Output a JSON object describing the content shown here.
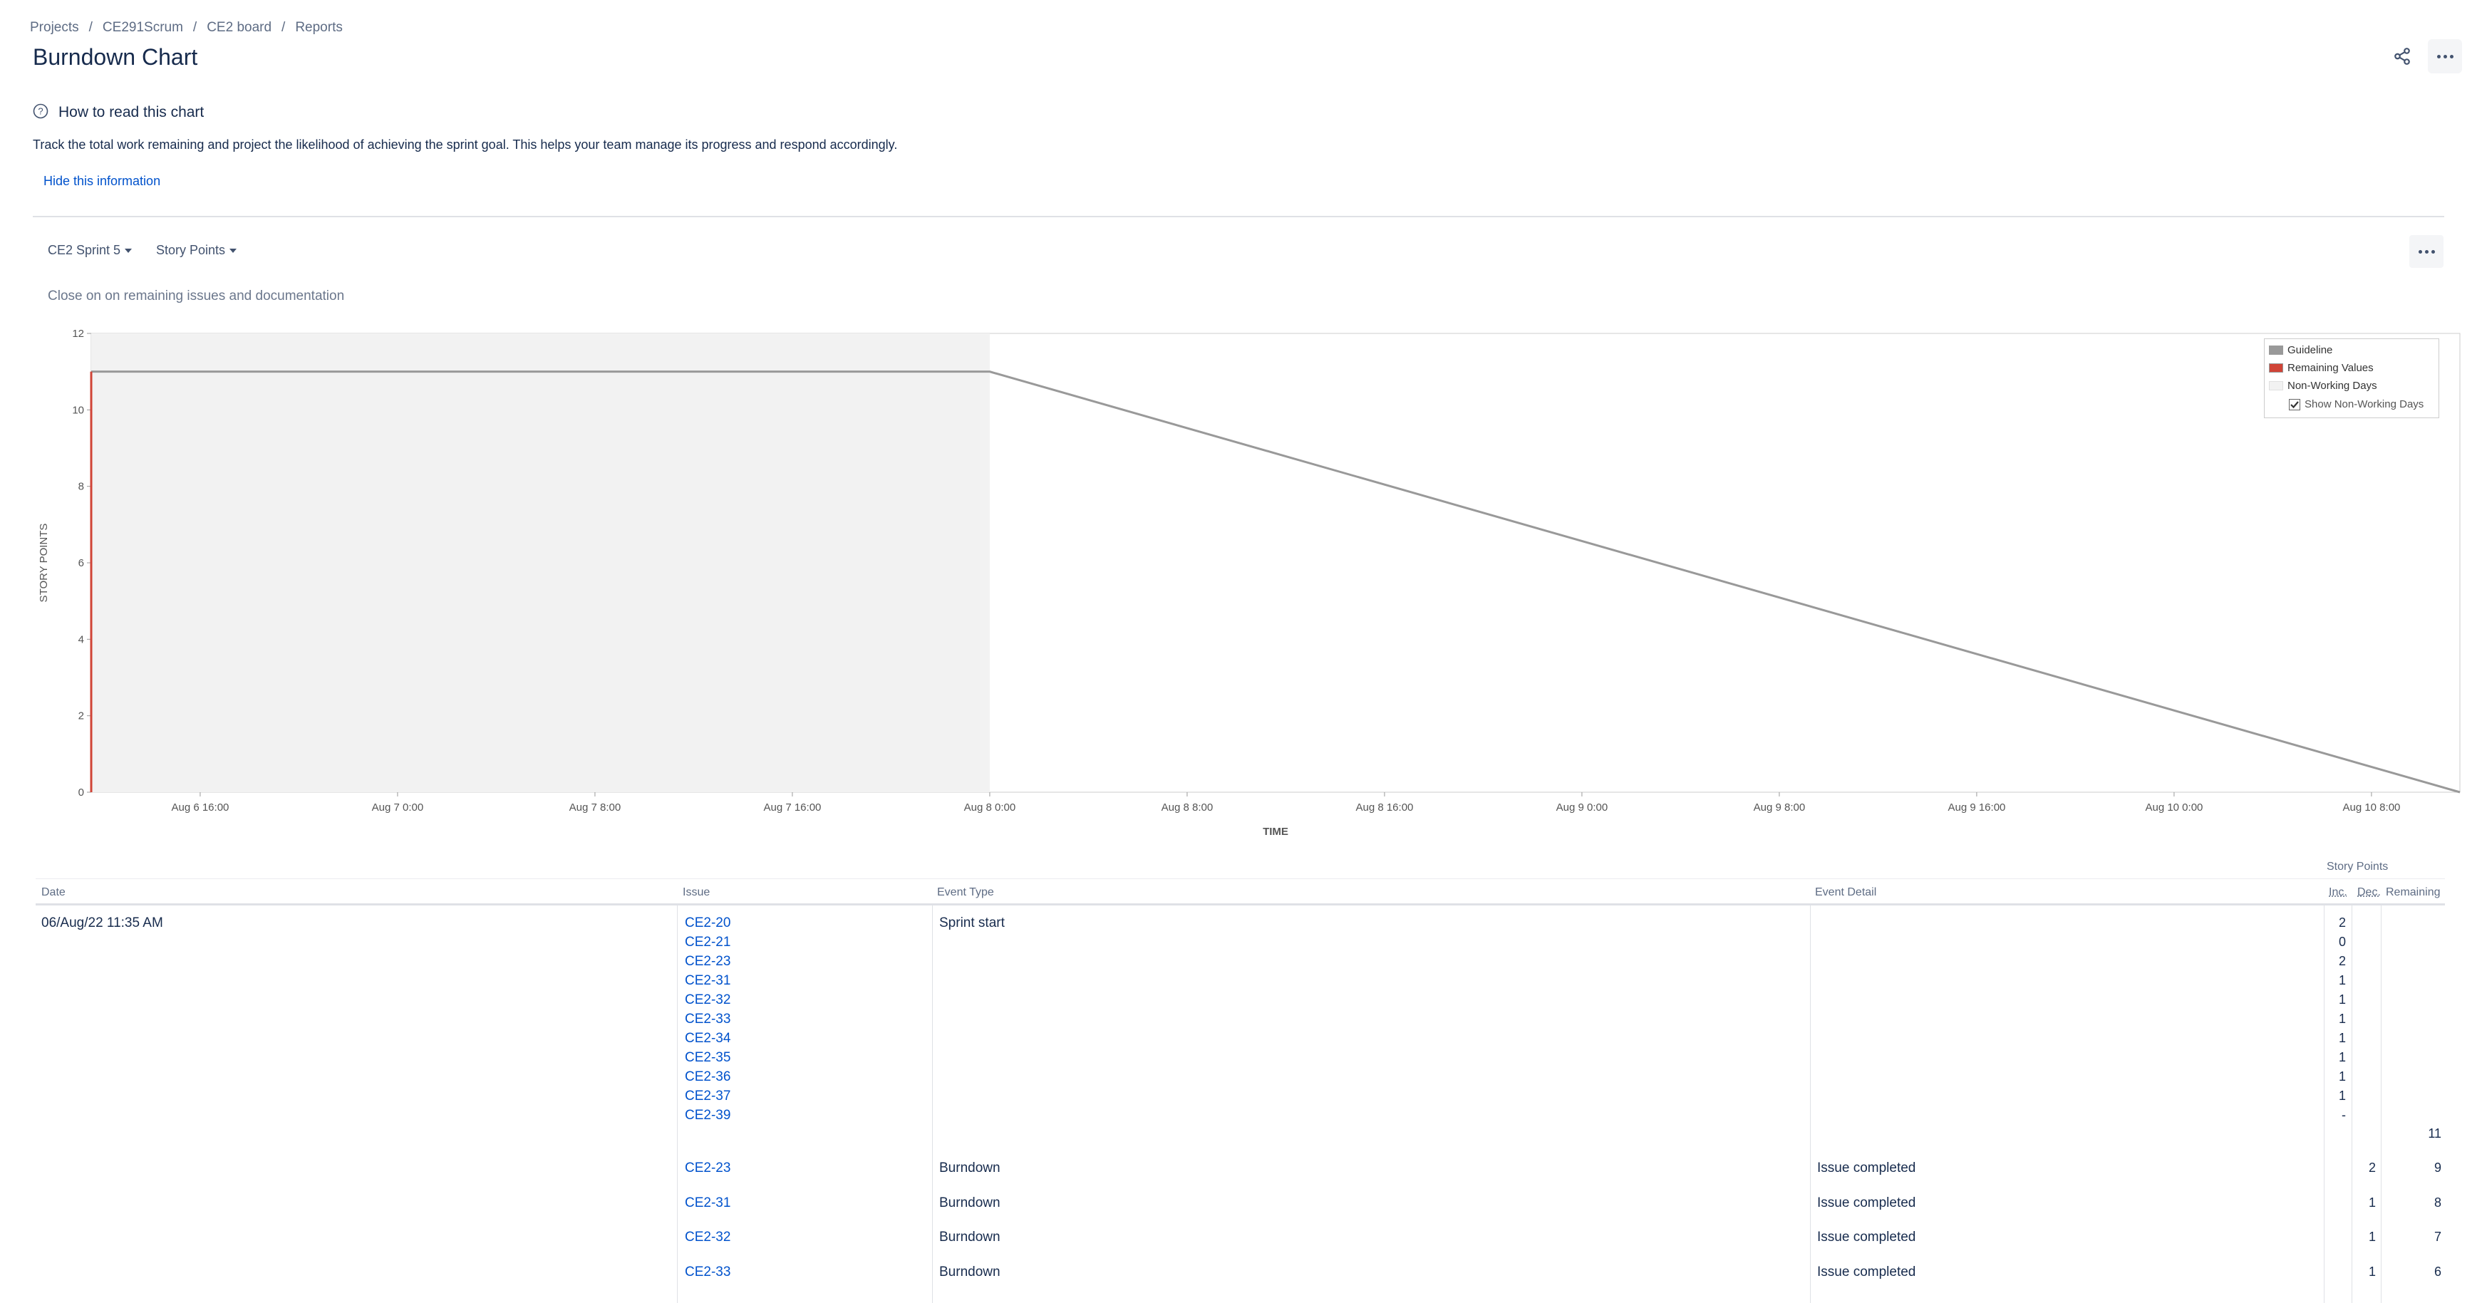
{
  "breadcrumb": [
    "Projects",
    "CE291Scrum",
    "CE2 board",
    "Reports"
  ],
  "page_title": "Burndown Chart",
  "info": {
    "title": "How to read this chart",
    "text": "Track the total work remaining and project the likelihood of achieving the sprint goal. This helps your team manage its progress and respond accordingly.",
    "hide_link": "Hide this information"
  },
  "controls": {
    "sprint": "CE2 Sprint 5",
    "statistic": "Story Points",
    "sprint_goal": "Close on on remaining issues and documentation"
  },
  "legend": {
    "guideline": "Guideline",
    "remaining": "Remaining Values",
    "non_working": "Non-Working Days",
    "show_non_working": "Show Non-Working Days"
  },
  "colors": {
    "guideline": "#999999",
    "remaining": "#d04437",
    "non_working": "#f2f2f2",
    "link": "#0052cc"
  },
  "chart_data": {
    "type": "line",
    "ylabel": "STORY POINTS",
    "xlabel": "TIME",
    "ylim": [
      0,
      12
    ],
    "yticks": [
      0,
      2,
      4,
      6,
      8,
      10,
      12
    ],
    "xlim": [
      "2022-08-06 11:35",
      "2022-08-10 11:35"
    ],
    "xticks": [
      "Aug 6 16:00",
      "Aug 7 0:00",
      "Aug 7 8:00",
      "Aug 7 16:00",
      "Aug 8 0:00",
      "Aug 8 8:00",
      "Aug 8 16:00",
      "Aug 9 0:00",
      "Aug 9 8:00",
      "Aug 9 16:00",
      "Aug 10 0:00",
      "Aug 10 8:00"
    ],
    "non_working_days": [
      [
        "2022-08-06 11:35",
        "2022-08-08 00:00"
      ]
    ],
    "legend_position": "top-right",
    "series": [
      {
        "name": "Guideline",
        "points": [
          [
            "2022-08-06 11:35",
            11
          ],
          [
            "2022-08-08 00:00",
            11
          ],
          [
            "2022-08-10 11:35",
            0
          ]
        ]
      },
      {
        "name": "Remaining Values",
        "points": [
          [
            "2022-08-06 11:35",
            0
          ],
          [
            "2022-08-06 11:35",
            11
          ]
        ]
      }
    ]
  },
  "table": {
    "group_header": "Story Points",
    "headers": {
      "date": "Date",
      "issue": "Issue",
      "event_type": "Event Type",
      "event_detail": "Event Detail",
      "inc": "Inc.",
      "dec": "Dec.",
      "remaining": "Remaining"
    },
    "start_event": {
      "date": "06/Aug/22 11:35 AM",
      "event_type": "Sprint start",
      "issues": [
        {
          "key": "CE2-20",
          "inc": "2"
        },
        {
          "key": "CE2-21",
          "inc": "0"
        },
        {
          "key": "CE2-23",
          "inc": "2"
        },
        {
          "key": "CE2-31",
          "inc": "1"
        },
        {
          "key": "CE2-32",
          "inc": "1"
        },
        {
          "key": "CE2-33",
          "inc": "1"
        },
        {
          "key": "CE2-34",
          "inc": "1"
        },
        {
          "key": "CE2-35",
          "inc": "1"
        },
        {
          "key": "CE2-36",
          "inc": "1"
        },
        {
          "key": "CE2-37",
          "inc": "1"
        },
        {
          "key": "CE2-39",
          "inc": "-"
        }
      ],
      "remaining": "11"
    },
    "events": [
      {
        "issue": "CE2-23",
        "event_type": "Burndown",
        "event_detail": "Issue completed",
        "dec": "2",
        "remaining": "9"
      },
      {
        "issue": "CE2-31",
        "event_type": "Burndown",
        "event_detail": "Issue completed",
        "dec": "1",
        "remaining": "8"
      },
      {
        "issue": "CE2-32",
        "event_type": "Burndown",
        "event_detail": "Issue completed",
        "dec": "1",
        "remaining": "7"
      },
      {
        "issue": "CE2-33",
        "event_type": "Burndown",
        "event_detail": "Issue completed",
        "dec": "1",
        "remaining": "6"
      }
    ]
  }
}
